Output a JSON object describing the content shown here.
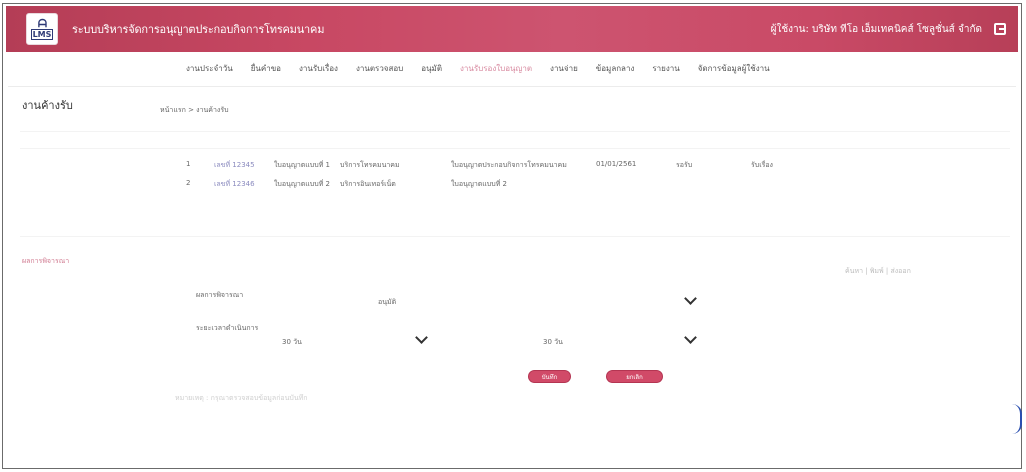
{
  "header": {
    "title": "ระบบบริหารจัดการอนุญาตประกอบกิจการโทรคมนาคม",
    "logo_text": "LMS",
    "user": "ผู้ใช้งาน: บริษัท ทีโอ เอ็มเทคนิคส์ โซลูชั่นส์ จำกัด"
  },
  "nav": {
    "items": [
      "งานประจำวัน",
      "ยื่นคำขอ",
      "งานรับเรื่อง",
      "งานตรวจสอบ",
      "อนุมัติ",
      "งานรับรองใบอนุญาต",
      "งานจ่าย",
      "ข้อมูลกลาง",
      "รายงาน",
      "จัดการข้อมูลผู้ใช้งาน"
    ],
    "active_index": 5
  },
  "page": {
    "title": "งานค้างรับ",
    "breadcrumb": "หน้าแรก > งานค้างรับ"
  },
  "table": {
    "rows": [
      {
        "no": "1",
        "id": "เลขที่ 12345",
        "type": "ใบอนุญาตแบบที่ 1",
        "service": "บริการโทรคมนาคม",
        "desc": "ใบอนุญาตประกอบกิจการโทรคมนาคม",
        "date": "01/01/2561",
        "status": "รอรับ",
        "action": "รับเรื่อง"
      },
      {
        "no": "2",
        "id": "เลขที่ 12346",
        "type": "ใบอนุญาตแบบที่ 2",
        "service": "บริการอินเทอร์เน็ต",
        "desc": "ใบอนุญาตแบบที่ 2",
        "date": "",
        "status": "",
        "action": ""
      }
    ]
  },
  "section": {
    "label": "ผลการพิจารณา",
    "tools": "ค้นหา  |  พิมพ์  |  ส่งออก"
  },
  "form": {
    "field1_label": "ผลการพิจารณา",
    "field1_value": "อนุมัติ",
    "field2_label": "ระยะเวลาดำเนินการ",
    "field2_value": "30 วัน",
    "field3_value": "30 วัน"
  },
  "buttons": {
    "save": "บันทึก",
    "cancel": "ยกเลิก"
  },
  "footer": {
    "text": "หมายเหตุ : กรุณาตรวจสอบข้อมูลก่อนบันทึก"
  }
}
